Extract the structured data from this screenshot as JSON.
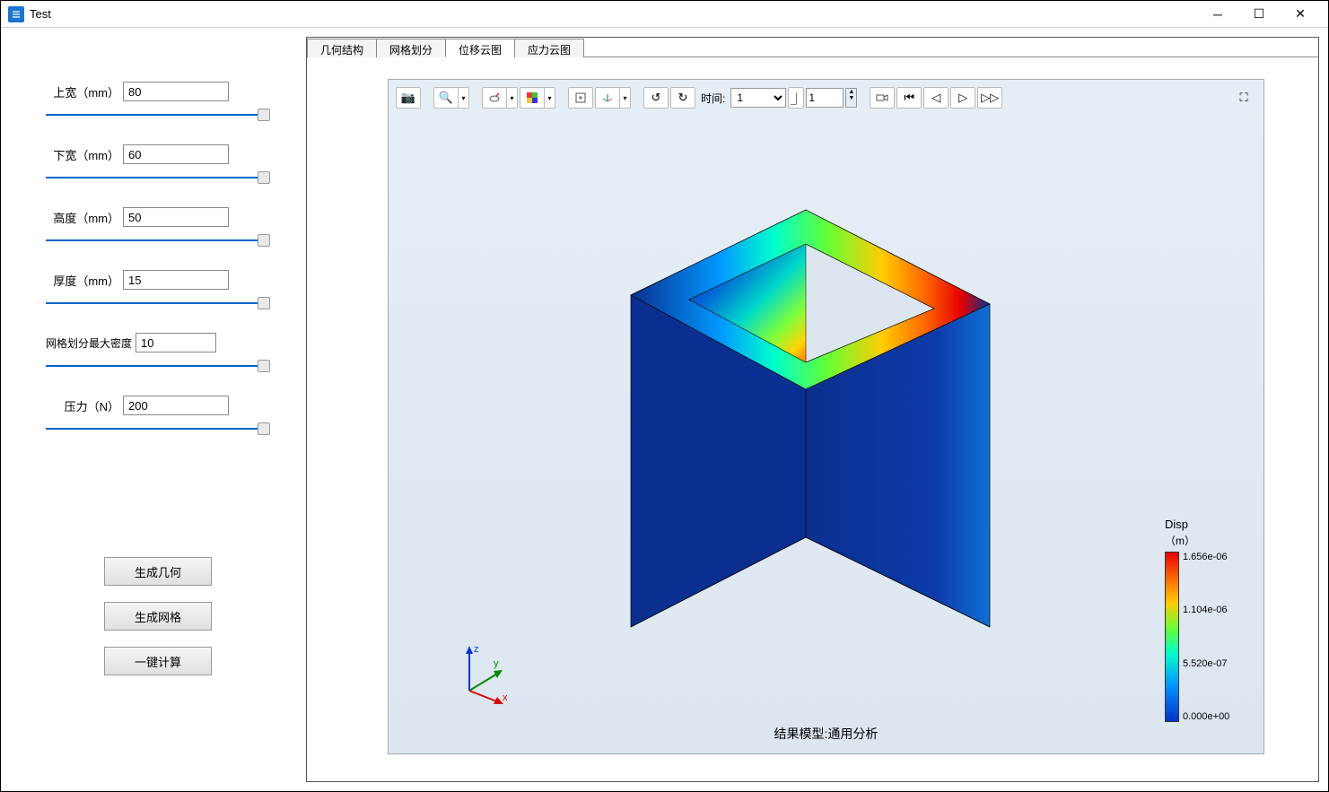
{
  "window": {
    "title": "Test"
  },
  "params": {
    "top_width": {
      "label": "上宽（mm）",
      "value": "80"
    },
    "bottom_width": {
      "label": "下宽（mm）",
      "value": "60"
    },
    "height": {
      "label": "高度（mm）",
      "value": "50"
    },
    "thickness": {
      "label": "厚度（mm）",
      "value": "15"
    },
    "mesh_density": {
      "label": "网格划分最大密度",
      "value": "10"
    },
    "pressure": {
      "label": "压力（N）",
      "value": "200"
    }
  },
  "buttons": {
    "gen_geometry": "生成几何",
    "gen_mesh": "生成网格",
    "one_click": "一键计算"
  },
  "tabs": [
    "几何结构",
    "网格划分",
    "位移云图",
    "应力云图"
  ],
  "active_tab": 2,
  "viewer": {
    "time_label": "时间:",
    "time_select": "1",
    "frame_select": "1",
    "result_caption": "结果模型:通用分析",
    "axes": {
      "x": "x",
      "y": "y",
      "z": "z"
    }
  },
  "legend": {
    "title": "Disp",
    "unit": "（m）",
    "ticks": [
      "1.656e-06",
      "1.104e-06",
      "5.520e-07",
      "0.000e+00"
    ]
  }
}
